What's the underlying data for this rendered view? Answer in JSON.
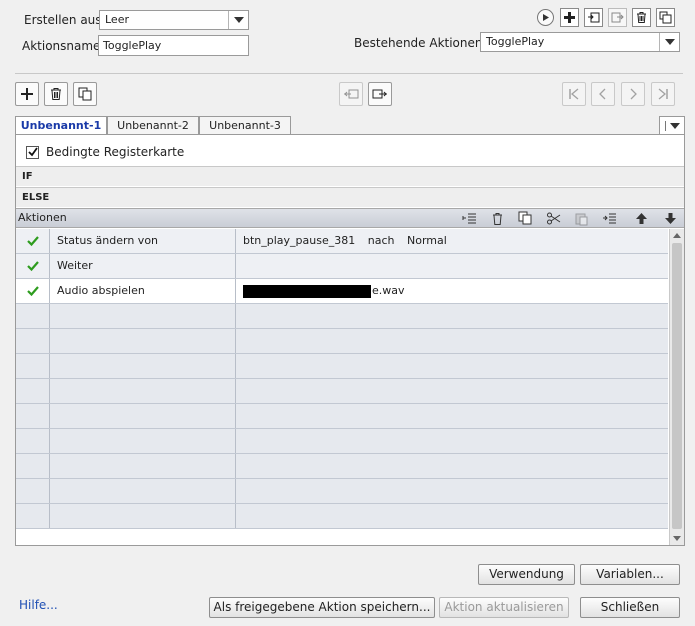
{
  "header": {
    "create_from_label": "Erstellen aus:",
    "create_from_value": "Leer",
    "action_name_label": "Aktionsname:",
    "action_name_value": "TogglePlay",
    "existing_label": "Bestehende Aktionen:",
    "existing_value": "TogglePlay"
  },
  "tabs": [
    "Unbenannt-1",
    "Unbenannt-2",
    "Unbenannt-3"
  ],
  "panel": {
    "conditional_label": "Bedingte Registerkarte",
    "conditional_checked": true,
    "if_label": "IF",
    "else_label": "ELSE",
    "actions_label": "Aktionen"
  },
  "actions": [
    {
      "action": "Status ändern von",
      "parts": [
        "btn_play_pause_381",
        "nach",
        "Normal"
      ],
      "checked": true
    },
    {
      "action": "Weiter",
      "parts": [],
      "checked": true
    },
    {
      "action": "Audio abspielen",
      "parts": [
        "e.wav"
      ],
      "checked": true,
      "redacted": true
    }
  ],
  "empty_rows": 9,
  "buttons": {
    "usage": "Verwendung",
    "variables": "Variablen...",
    "save_shared": "Als freigegebene Aktion speichern...",
    "update_action": "Aktion aktualisieren",
    "close": "Schließen",
    "help": "Hilfe..."
  },
  "icons": {
    "top_toolbar": [
      "play-icon",
      "add-icon",
      "import-icon",
      "export-icon",
      "delete-icon",
      "duplicate-icon"
    ],
    "decision_toolbar": [
      "add-decision-icon",
      "delete-decision-icon",
      "copy-decision-icon",
      "move-left-icon",
      "move-right-icon",
      "first-icon",
      "previous-icon",
      "next-icon",
      "last-icon"
    ],
    "actions_toolbar": [
      "insert-icon",
      "delete-icon",
      "copy-icon",
      "cut-icon",
      "paste-icon",
      "insert-after-icon",
      "move-up-icon",
      "move-down-icon"
    ]
  },
  "colors": {
    "accent": "#1a3aa8",
    "check": "#2e9c1e",
    "link": "#1f4fb4"
  }
}
